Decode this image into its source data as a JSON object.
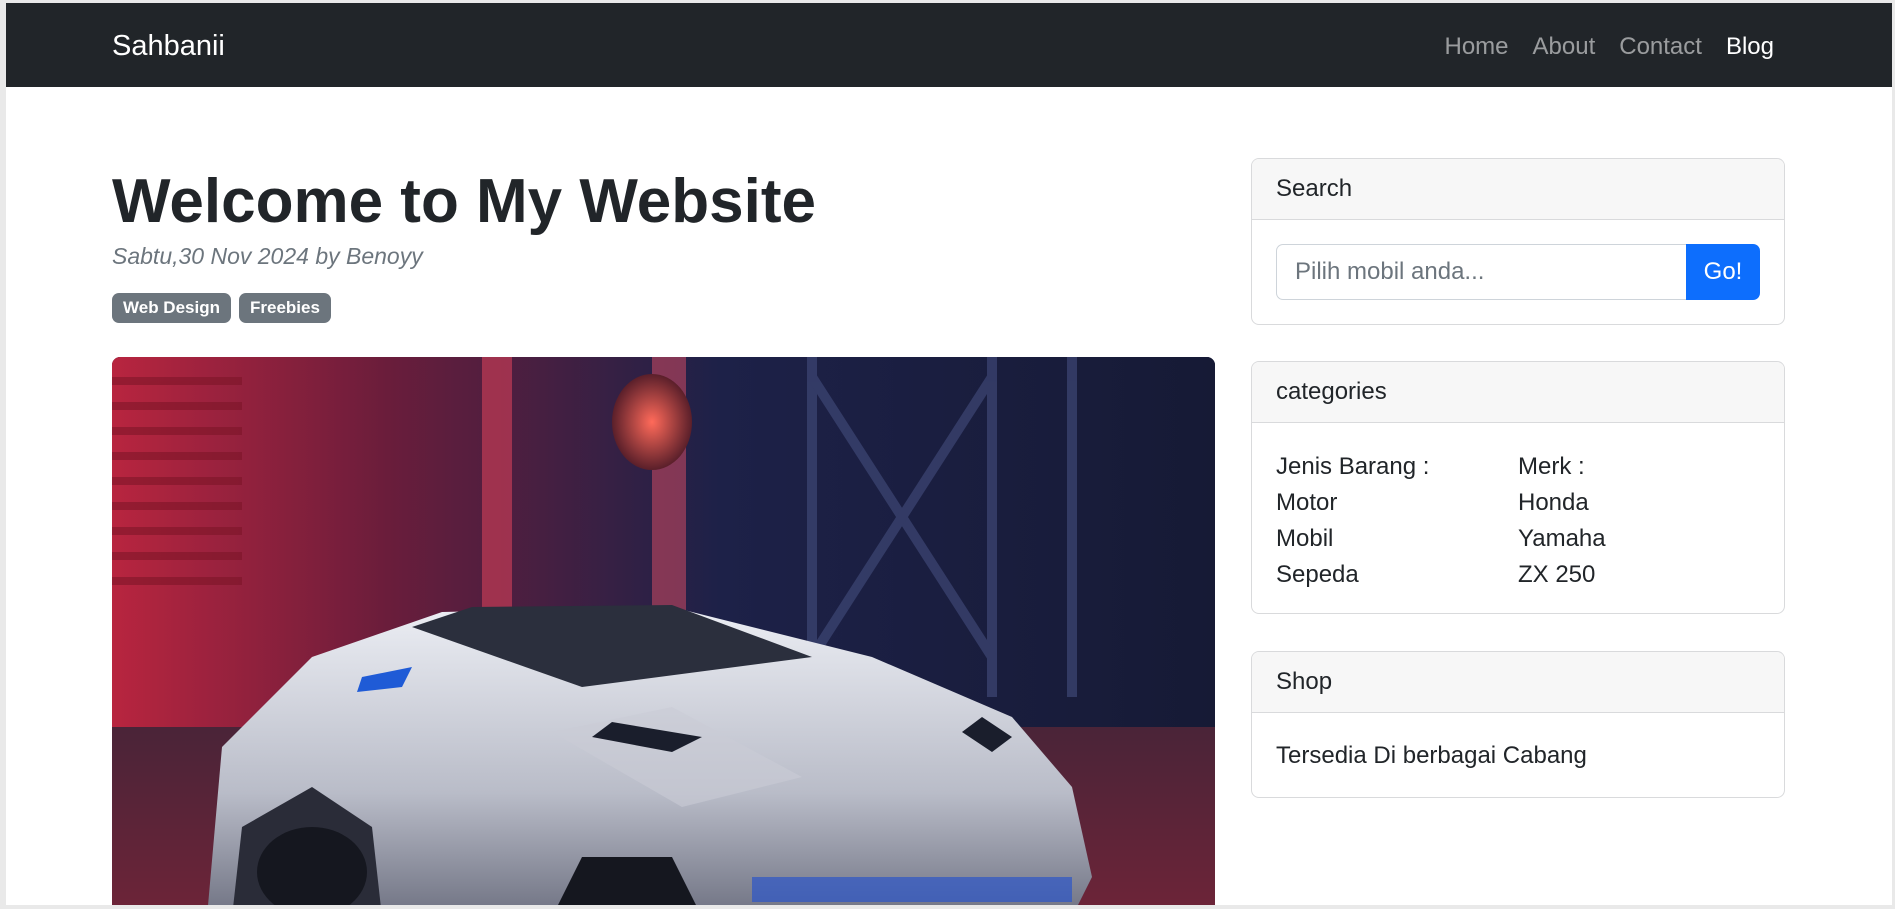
{
  "navbar": {
    "brand": "Sahbanii",
    "links": [
      {
        "label": "Home"
      },
      {
        "label": "About"
      },
      {
        "label": "Contact"
      },
      {
        "label": "Blog"
      }
    ]
  },
  "post": {
    "title": "Welcome to My Website",
    "meta": "Sabtu,30 Nov 2024 by Benoyy",
    "badges": [
      "Web Design",
      "Freebies"
    ]
  },
  "sidebar": {
    "search": {
      "header": "Search",
      "placeholder": "Pilih mobil anda...",
      "button": "Go!"
    },
    "categories": {
      "header": "categories",
      "left": [
        "Jenis Barang :",
        "Motor",
        "Mobil",
        "Sepeda"
      ],
      "right": [
        "Merk :",
        "Honda",
        "Yamaha",
        "ZX 250"
      ]
    },
    "shop": {
      "header": "Shop",
      "text": "Tersedia Di berbagai Cabang"
    }
  },
  "colors": {
    "navbar_bg": "#212529",
    "primary": "#0d6efd",
    "badge": "#6c757d"
  }
}
